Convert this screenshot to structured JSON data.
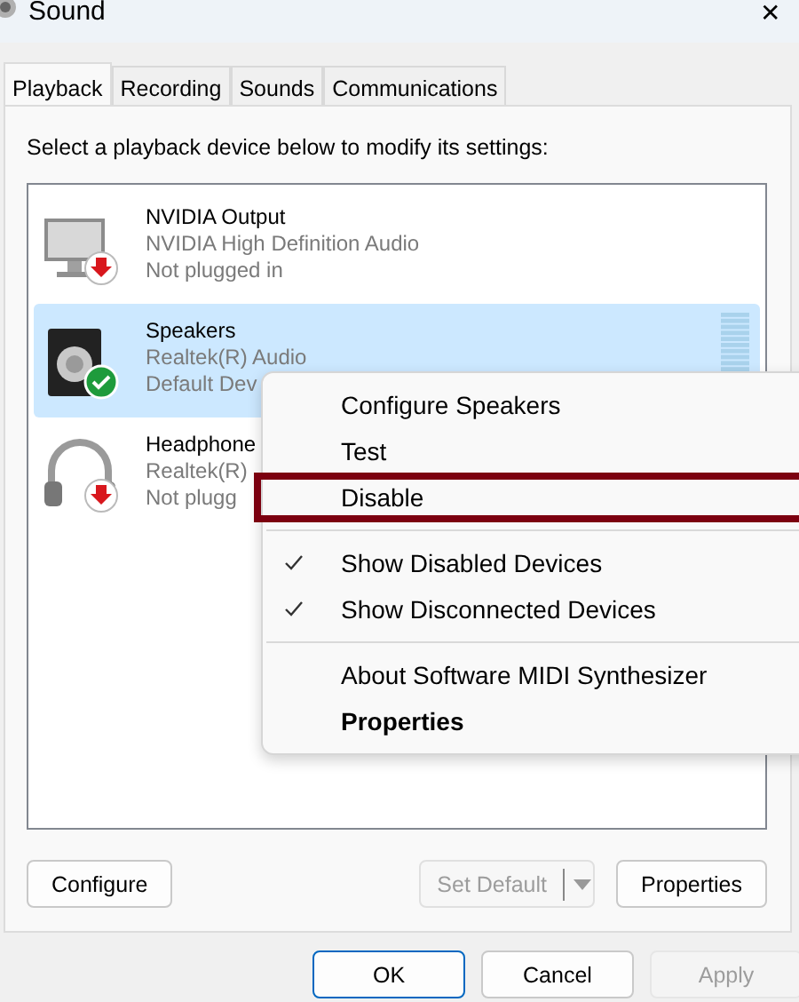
{
  "window": {
    "title": "Sound",
    "close": "✕"
  },
  "tabs": [
    {
      "label": "Playback",
      "selected": true
    },
    {
      "label": "Recording",
      "selected": false
    },
    {
      "label": "Sounds",
      "selected": false
    },
    {
      "label": "Communications",
      "selected": false
    }
  ],
  "instruction": "Select a playback device below to modify its settings:",
  "devices": [
    {
      "name": "NVIDIA Output",
      "driver": "NVIDIA High Definition Audio",
      "status": "Not plugged in",
      "kind": "monitor",
      "plugged_in": false,
      "default_device": false,
      "selected": false
    },
    {
      "name": "Speakers",
      "driver": "Realtek(R) Audio",
      "status": "Default Dev",
      "kind": "speaker",
      "plugged_in": true,
      "default_device": true,
      "selected": true
    },
    {
      "name": "Headphone",
      "driver": "Realtek(R)",
      "status": "Not plugg",
      "kind": "headphones",
      "plugged_in": false,
      "default_device": false,
      "selected": false
    }
  ],
  "context_menu": [
    {
      "kind": "item",
      "label": "Configure Speakers",
      "checked": false,
      "default": false,
      "highlighted": false
    },
    {
      "kind": "item",
      "label": "Test",
      "checked": false,
      "default": false,
      "highlighted": false
    },
    {
      "kind": "item",
      "label": "Disable",
      "checked": false,
      "default": false,
      "highlighted": true
    },
    {
      "kind": "separator"
    },
    {
      "kind": "item",
      "label": "Show Disabled Devices",
      "checked": true,
      "default": false,
      "highlighted": false
    },
    {
      "kind": "item",
      "label": "Show Disconnected Devices",
      "checked": true,
      "default": false,
      "highlighted": false
    },
    {
      "kind": "separator"
    },
    {
      "kind": "item",
      "label": "About Software MIDI Synthesizer",
      "checked": false,
      "default": false,
      "highlighted": false
    },
    {
      "kind": "item",
      "label": "Properties",
      "checked": false,
      "default": true,
      "highlighted": false
    }
  ],
  "panel_buttons": {
    "configure": "Configure",
    "set_default": {
      "label": "Set Default",
      "disabled": true
    },
    "properties": "Properties"
  },
  "dialog_buttons": [
    {
      "label": "OK",
      "disabled": false,
      "focused": true
    },
    {
      "label": "Cancel",
      "disabled": false,
      "focused": false
    },
    {
      "label": "Apply",
      "disabled": true,
      "focused": false
    }
  ]
}
